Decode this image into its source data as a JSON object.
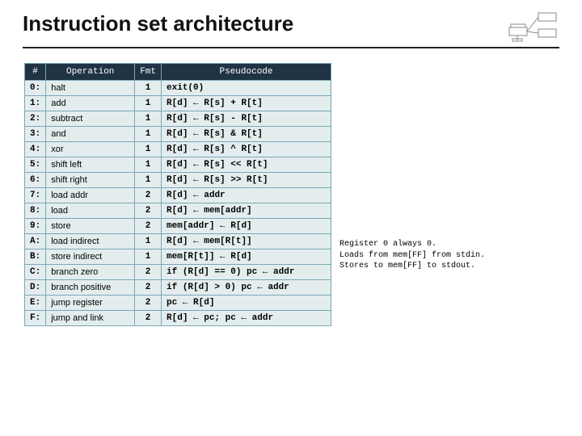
{
  "title": "Instruction set architecture",
  "headers": {
    "num": "#",
    "op": "Operation",
    "fmt": "Fmt",
    "code": "Pseudocode"
  },
  "rows": [
    {
      "num": "0:",
      "op": "halt",
      "fmt": "1",
      "code": "exit(0)"
    },
    {
      "num": "1:",
      "op": "add",
      "fmt": "1",
      "code": "R[d] ← R[s]  +  R[t]"
    },
    {
      "num": "2:",
      "op": "subtract",
      "fmt": "1",
      "code": "R[d] ← R[s]  -  R[t]"
    },
    {
      "num": "3:",
      "op": "and",
      "fmt": "1",
      "code": "R[d] ← R[s]  &  R[t]"
    },
    {
      "num": "4:",
      "op": "xor",
      "fmt": "1",
      "code": "R[d] ← R[s]  ^  R[t]"
    },
    {
      "num": "5:",
      "op": "shift left",
      "fmt": "1",
      "code": "R[d] ← R[s]  << R[t]"
    },
    {
      "num": "6:",
      "op": "shift right",
      "fmt": "1",
      "code": "R[d] ← R[s]  >> R[t]"
    },
    {
      "num": "7:",
      "op": "load addr",
      "fmt": "2",
      "code": "R[d] ← addr"
    },
    {
      "num": "8:",
      "op": "load",
      "fmt": "2",
      "code": "R[d] ← mem[addr]"
    },
    {
      "num": "9:",
      "op": "store",
      "fmt": "2",
      "code": "mem[addr] ← R[d]"
    },
    {
      "num": "A:",
      "op": "load indirect",
      "fmt": "1",
      "code": "R[d] ← mem[R[t]]"
    },
    {
      "num": "B:",
      "op": "store indirect",
      "fmt": "1",
      "code": "mem[R[t]] ← R[d]"
    },
    {
      "num": "C:",
      "op": "branch zero",
      "fmt": "2",
      "code": "if (R[d] == 0) pc ← addr"
    },
    {
      "num": "D:",
      "op": "branch positive",
      "fmt": "2",
      "code": "if (R[d] > 0)  pc ← addr"
    },
    {
      "num": "E:",
      "op": "jump register",
      "fmt": "2",
      "code": "pc ← R[d]"
    },
    {
      "num": "F:",
      "op": "jump and link",
      "fmt": "2",
      "code": "R[d] ← pc; pc ← addr"
    }
  ],
  "notes": [
    "Register 0 always 0.",
    "Loads from mem[FF] from stdin.",
    "Stores to mem[FF] to stdout."
  ],
  "chart_data": {
    "type": "table",
    "title": "Instruction set architecture",
    "columns": [
      "#",
      "Operation",
      "Fmt",
      "Pseudocode"
    ],
    "rows": [
      [
        "0:",
        "halt",
        "1",
        "exit(0)"
      ],
      [
        "1:",
        "add",
        "1",
        "R[d] ← R[s] + R[t]"
      ],
      [
        "2:",
        "subtract",
        "1",
        "R[d] ← R[s] - R[t]"
      ],
      [
        "3:",
        "and",
        "1",
        "R[d] ← R[s] & R[t]"
      ],
      [
        "4:",
        "xor",
        "1",
        "R[d] ← R[s] ^ R[t]"
      ],
      [
        "5:",
        "shift left",
        "1",
        "R[d] ← R[s] << R[t]"
      ],
      [
        "6:",
        "shift right",
        "1",
        "R[d] ← R[s] >> R[t]"
      ],
      [
        "7:",
        "load addr",
        "2",
        "R[d] ← addr"
      ],
      [
        "8:",
        "load",
        "2",
        "R[d] ← mem[addr]"
      ],
      [
        "9:",
        "store",
        "2",
        "mem[addr] ← R[d]"
      ],
      [
        "A:",
        "load indirect",
        "1",
        "R[d] ← mem[R[t]]"
      ],
      [
        "B:",
        "store indirect",
        "1",
        "mem[R[t]] ← R[d]"
      ],
      [
        "C:",
        "branch zero",
        "2",
        "if (R[d] == 0) pc ← addr"
      ],
      [
        "D:",
        "branch positive",
        "2",
        "if (R[d] > 0) pc ← addr"
      ],
      [
        "E:",
        "jump register",
        "2",
        "pc ← R[d]"
      ],
      [
        "F:",
        "jump and link",
        "2",
        "R[d] ← pc; pc ← addr"
      ]
    ]
  }
}
